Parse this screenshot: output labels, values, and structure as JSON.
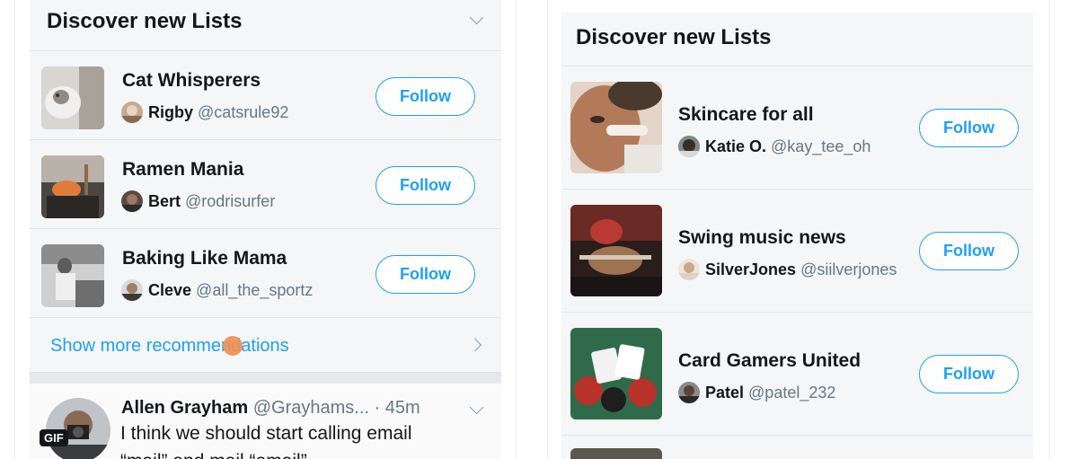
{
  "left_panel": {
    "title": "Discover new Lists",
    "lists": [
      {
        "name": "Cat Whisperers",
        "owner_name": "Rigby",
        "owner_handle": "@catsrule92",
        "follow_label": "Follow"
      },
      {
        "name": "Ramen Mania",
        "owner_name": "Bert",
        "owner_handle": "@rodrisurfer",
        "follow_label": "Follow"
      },
      {
        "name": "Baking Like Mama",
        "owner_name": "Cleve",
        "owner_handle": "@all_the_sportz",
        "follow_label": "Follow"
      }
    ],
    "show_more": "Show more recommendations",
    "tweet": {
      "author": "Allen Grayham",
      "handle": "@Grayhams...",
      "time": "· 45m",
      "text": "I think we should start calling email",
      "text_cut": "“mail” and mail “email”",
      "gif_badge": "GIF"
    }
  },
  "right_panel": {
    "title": "Discover new Lists",
    "lists": [
      {
        "name": "Skincare for all",
        "owner_name": "Katie O.",
        "owner_handle": "@kay_tee_oh",
        "follow_label": "Follow"
      },
      {
        "name": "Swing music news",
        "owner_name": "SilverJones",
        "owner_handle": "@siilverjones",
        "follow_label": "Follow"
      },
      {
        "name": "Card Gamers United",
        "owner_name": "Patel",
        "owner_handle": "@patel_232",
        "follow_label": "Follow"
      }
    ]
  },
  "colors": {
    "accent": "#1da1f2",
    "touch_indicator": "#ef8f52",
    "secondary_text": "#657786"
  }
}
